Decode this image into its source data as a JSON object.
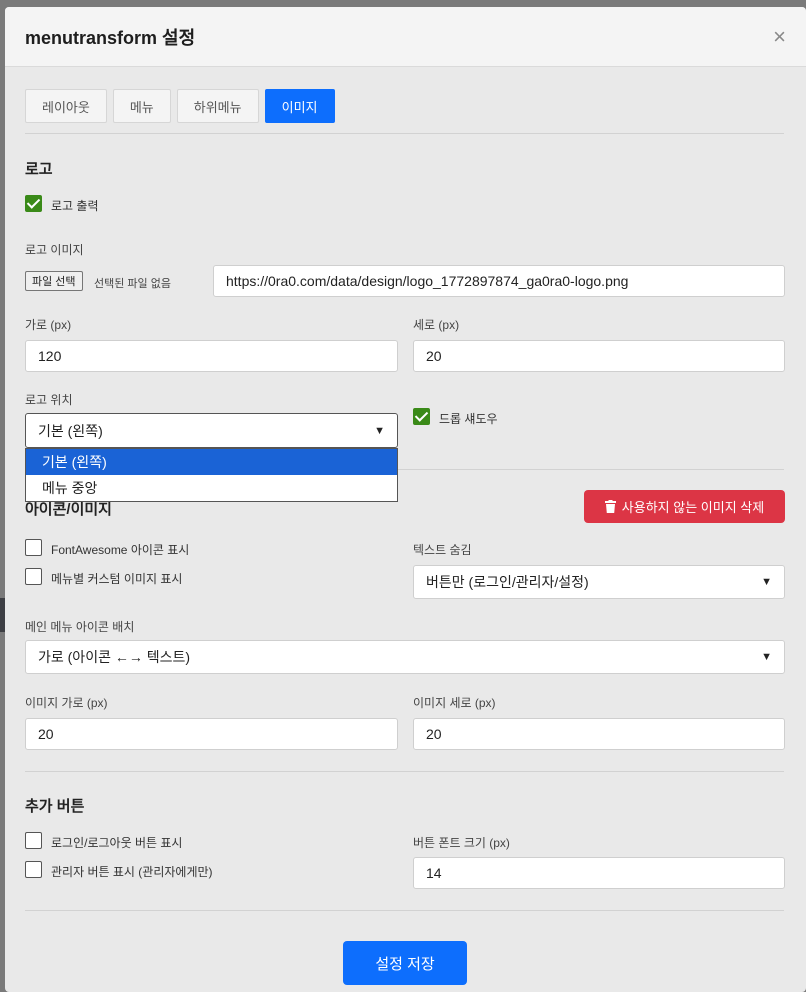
{
  "modal": {
    "title": "menutransform 설정",
    "close_glyph": "×"
  },
  "tabs": [
    {
      "label": "레이아웃",
      "active": false
    },
    {
      "label": "메뉴",
      "active": false
    },
    {
      "label": "하위메뉴",
      "active": false
    },
    {
      "label": "이미지",
      "active": true
    }
  ],
  "logo": {
    "section_title": "로고",
    "show_logo_label": "로고 출력",
    "show_logo_checked": true,
    "image_label": "로고 이미지",
    "file_button": "파일 선택",
    "file_status": "선택된 파일 없음",
    "url_value": "https://0ra0.com/data/design/logo_1772897874_ga0ra0-logo.png",
    "width_label": "가로 (px)",
    "width_value": "120",
    "height_label": "세로 (px)",
    "height_value": "20",
    "position_label": "로고 위치",
    "position_selected": "기본 (왼쪽)",
    "position_options": [
      "기본 (왼쪽)",
      "메뉴 중앙"
    ],
    "drop_shadow_label": "드롭 섀도우",
    "drop_shadow_checked": true
  },
  "icons": {
    "section_title": "아이콘/이미지",
    "delete_button": "사용하지 않는 이미지 삭제",
    "fontawesome_label": "FontAwesome 아이콘 표시",
    "custom_image_label": "메뉴별 커스텀 이미지 표시",
    "hide_text_label": "텍스트 숨김",
    "hide_text_value": "버튼만 (로그인/관리자/설정)",
    "layout_label": "메인 메뉴 아이콘 배치",
    "layout_value": "가로 (아이콘 ←→ 텍스트)",
    "img_width_label": "이미지 가로 (px)",
    "img_width_value": "20",
    "img_height_label": "이미지 세로 (px)",
    "img_height_value": "20"
  },
  "extra": {
    "section_title": "추가 버튼",
    "login_label": "로그인/로그아웃 버튼 표시",
    "admin_label": "관리자 버튼 표시 (관리자에게만)",
    "font_size_label": "버튼 폰트 크기 (px)",
    "font_size_value": "14"
  },
  "save_button": "설정 저장",
  "icon_names": [
    "close-icon",
    "chevron-down-icon",
    "trash-icon",
    "check-icon"
  ]
}
